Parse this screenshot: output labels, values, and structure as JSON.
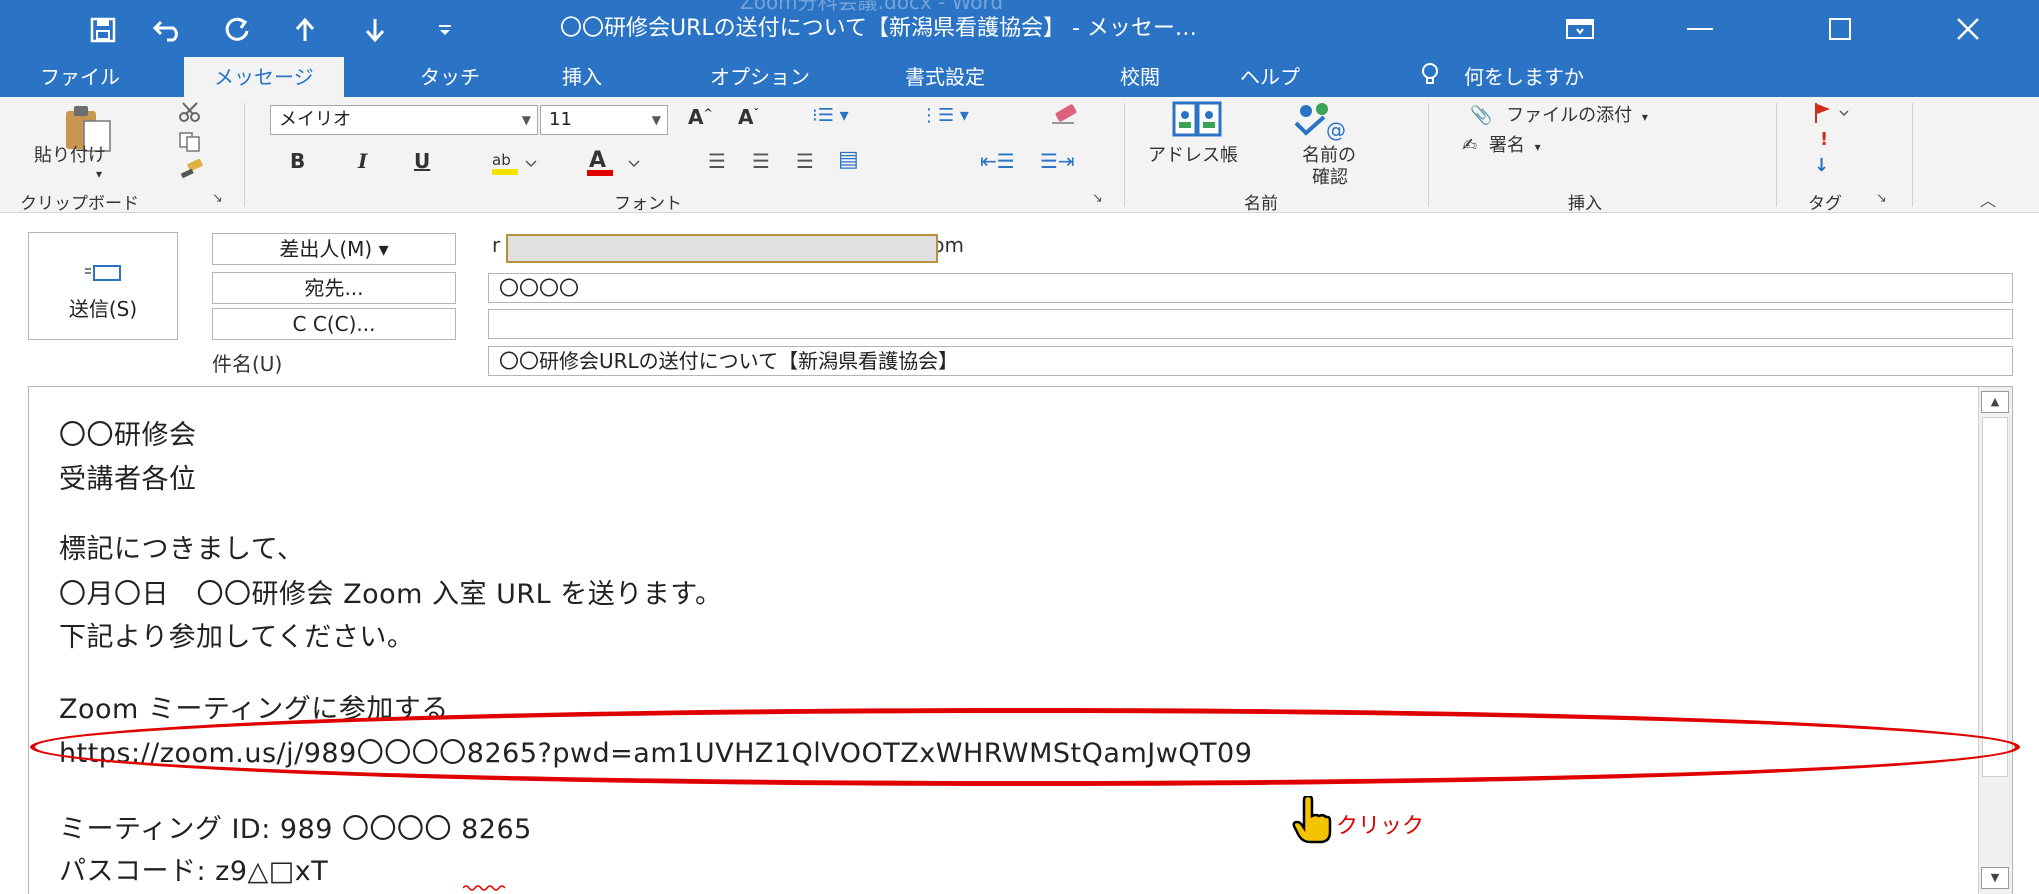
{
  "window": {
    "watermark": "Zoom分科会議.docx - Word",
    "title": "〇〇研修会URLの送付について【新潟県看護協会】 - メッセー…",
    "controls": [
      "restore-ribbon-icon",
      "minimize-icon",
      "maximize-icon",
      "close-icon"
    ]
  },
  "quick_access": [
    "save-icon",
    "undo-icon",
    "redo-icon",
    "up-arrow-icon",
    "down-arrow-icon",
    "customize-icon"
  ],
  "tabs": [
    "ファイル",
    "メッセージ",
    "タッチ",
    "挿入",
    "オプション",
    "書式設定",
    "校閲",
    "ヘルプ"
  ],
  "active_tab": "メッセージ",
  "tell_me": "何をしますか",
  "ribbon": {
    "clipboard": {
      "paste": "貼り付け",
      "label": "クリップボード"
    },
    "font": {
      "name": "メイリオ",
      "size": "11",
      "label": "フォント",
      "bold": "B",
      "italic": "I",
      "underline": "U"
    },
    "names": {
      "address_book": "アドレス帳",
      "check_names_1": "名前の",
      "check_names_2": "確認",
      "label": "名前"
    },
    "include": {
      "attach": "ファイルの添付",
      "signature": "署名",
      "label": "挿入"
    },
    "tags": {
      "label": "タグ"
    }
  },
  "compose": {
    "send": "送信(S)",
    "from_button": "差出人(M) ▾",
    "from_prefix": "r",
    "from_suffix": "om",
    "to_button": "宛先...",
    "to_value": "〇〇〇〇",
    "cc_button": "C C(C)...",
    "cc_value": "",
    "subject_label": "件名(U)",
    "subject_value": "〇〇研修会URLの送付について【新潟県看護協会】"
  },
  "message_body": [
    "〇〇研修会",
    "受講者各位",
    "標記につきまして、",
    "〇月〇日　〇〇研修会 Zoom 入室 URL を送ります。",
    "下記より参加してください。",
    "Zoom ミーティングに参加する",
    "https://zoom.us/j/989〇〇〇〇8265?pwd=am1UVHZ1QlVOOTZxWHRWMStQamJwQT09",
    "ミーティング ID: 989  〇〇〇〇  8265",
    "パスコード: z9△□xT"
  ],
  "annotation": {
    "click_label": "クリック",
    "highlight_color": "#e00000"
  },
  "colors": {
    "title_bar": "#2b73c5",
    "ribbon": "#f3f3f3",
    "highlight": "#e00000"
  }
}
